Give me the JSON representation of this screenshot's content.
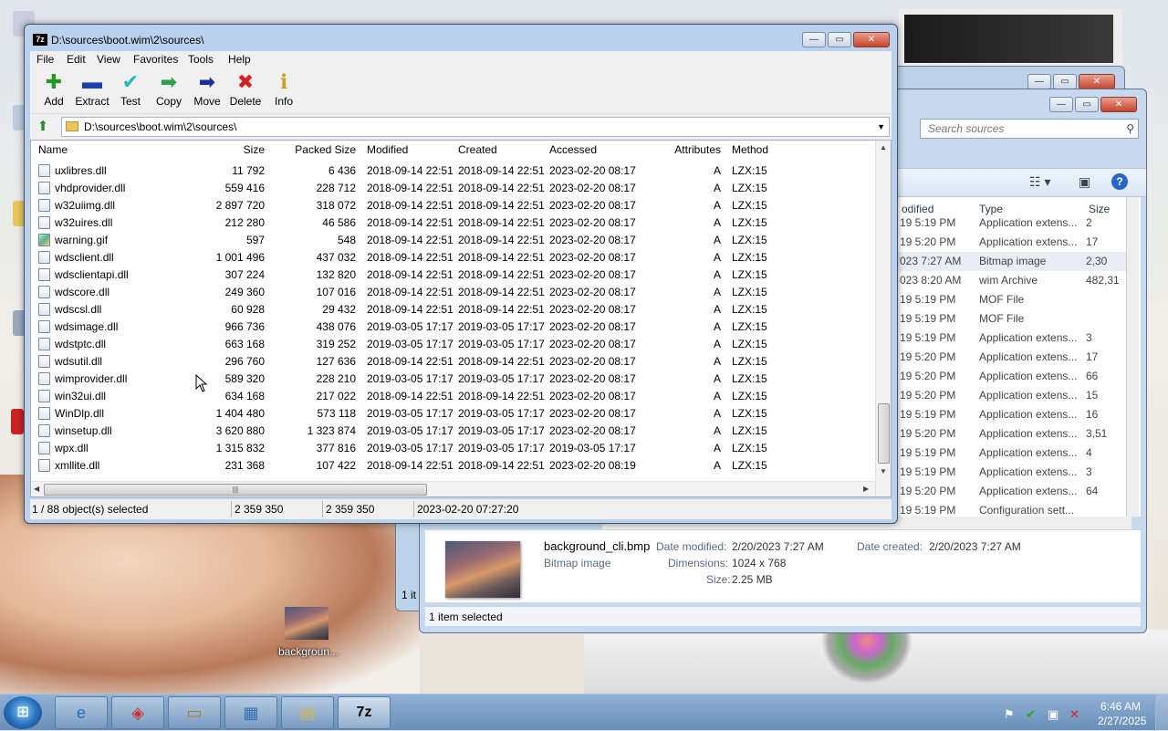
{
  "explorer": {
    "search_placeholder": "Search sources",
    "columns": {
      "modified": "odified",
      "type": "Type",
      "size": "Size"
    },
    "rows": [
      {
        "modified": "19 5:19 PM",
        "type": "Application extens...",
        "size": "2"
      },
      {
        "modified": "19 5:20 PM",
        "type": "Application extens...",
        "size": "17"
      },
      {
        "modified": "023 7:27 AM",
        "type": "Bitmap image",
        "size": "2,30"
      },
      {
        "modified": "023 8:20 AM",
        "type": "wim Archive",
        "size": "482,31"
      },
      {
        "modified": "19 5:19 PM",
        "type": "MOF File",
        "size": ""
      },
      {
        "modified": "19 5:19 PM",
        "type": "MOF File",
        "size": ""
      },
      {
        "modified": "19 5:19 PM",
        "type": "Application extens...",
        "size": "3"
      },
      {
        "modified": "19 5:20 PM",
        "type": "Application extens...",
        "size": "17"
      },
      {
        "modified": "19 5:20 PM",
        "type": "Application extens...",
        "size": "66"
      },
      {
        "modified": "19 5:20 PM",
        "type": "Application extens...",
        "size": "15"
      },
      {
        "modified": "19 5:19 PM",
        "type": "Application extens...",
        "size": "16"
      },
      {
        "modified": "19 5:20 PM",
        "type": "Application extens...",
        "size": "3,51"
      },
      {
        "modified": "19 5:19 PM",
        "type": "Application extens...",
        "size": "4"
      },
      {
        "modified": "19 5:19 PM",
        "type": "Application extens...",
        "size": "3"
      },
      {
        "modified": "19 5:20 PM",
        "type": "Application extens...",
        "size": "64"
      },
      {
        "modified": "19 5:19 PM",
        "type": "Configuration sett...",
        "size": ""
      }
    ],
    "details": {
      "filename": "background_cli.bmp",
      "filetype": "Bitmap image",
      "date_modified_label": "Date modified:",
      "date_modified": "2/20/2023 7:27 AM",
      "date_created_label": "Date created:",
      "date_created": "2/20/2023 7:27 AM",
      "dimensions_label": "Dimensions:",
      "dimensions": "1024 x 768",
      "size_label": "Size:",
      "size": "2.25 MB"
    },
    "status": "1 item selected",
    "back_status": "1 it"
  },
  "zip": {
    "title": "D:\\sources\\boot.wim\\2\\sources\\",
    "app_icon": "7z",
    "menu": [
      "File",
      "Edit",
      "View",
      "Favorites",
      "Tools",
      "Help"
    ],
    "toolbar": [
      {
        "label": "Add",
        "icon": "plus-icon",
        "glyph": "✚",
        "color": "#1f9a1f"
      },
      {
        "label": "Extract",
        "icon": "minus-icon",
        "glyph": "▬",
        "color": "#1c3fb0"
      },
      {
        "label": "Test",
        "icon": "check-icon",
        "glyph": "✔",
        "color": "#27b7b7"
      },
      {
        "label": "Copy",
        "icon": "copy-arrow-icon",
        "glyph": "➡",
        "color": "#2aa04a"
      },
      {
        "label": "Move",
        "icon": "move-arrow-icon",
        "glyph": "➡",
        "color": "#1b2f9a"
      },
      {
        "label": "Delete",
        "icon": "delete-x-icon",
        "glyph": "✖",
        "color": "#d42020"
      },
      {
        "label": "Info",
        "icon": "info-icon",
        "glyph": "ℹ",
        "color": "#c7a21c"
      }
    ],
    "address": "D:\\sources\\boot.wim\\2\\sources\\",
    "columns": [
      "Name",
      "Size",
      "Packed Size",
      "Modified",
      "Created",
      "Accessed",
      "Attributes",
      "Method"
    ],
    "files": [
      {
        "name": "uxlibres.dll",
        "size": "11 792",
        "packed": "6 436",
        "modified": "2018-09-14 22:51",
        "created": "2018-09-14 22:51",
        "accessed": "2023-02-20 08:17",
        "attr": "A",
        "method": "LZX:15",
        "icon": "dll"
      },
      {
        "name": "vhdprovider.dll",
        "size": "559 416",
        "packed": "228 712",
        "modified": "2018-09-14 22:51",
        "created": "2018-09-14 22:51",
        "accessed": "2023-02-20 08:17",
        "attr": "A",
        "method": "LZX:15",
        "icon": "dll"
      },
      {
        "name": "w32uiimg.dll",
        "size": "2 897 720",
        "packed": "318 072",
        "modified": "2018-09-14 22:51",
        "created": "2018-09-14 22:51",
        "accessed": "2023-02-20 08:17",
        "attr": "A",
        "method": "LZX:15",
        "icon": "dll"
      },
      {
        "name": "w32uires.dll",
        "size": "212 280",
        "packed": "46 586",
        "modified": "2018-09-14 22:51",
        "created": "2018-09-14 22:51",
        "accessed": "2023-02-20 08:17",
        "attr": "A",
        "method": "LZX:15",
        "icon": "dll"
      },
      {
        "name": "warning.gif",
        "size": "597",
        "packed": "548",
        "modified": "2018-09-14 22:51",
        "created": "2018-09-14 22:51",
        "accessed": "2023-02-20 08:17",
        "attr": "A",
        "method": "LZX:15",
        "icon": "img"
      },
      {
        "name": "wdsclient.dll",
        "size": "1 001 496",
        "packed": "437 032",
        "modified": "2018-09-14 22:51",
        "created": "2018-09-14 22:51",
        "accessed": "2023-02-20 08:17",
        "attr": "A",
        "method": "LZX:15",
        "icon": "dll"
      },
      {
        "name": "wdsclientapi.dll",
        "size": "307 224",
        "packed": "132 820",
        "modified": "2018-09-14 22:51",
        "created": "2018-09-14 22:51",
        "accessed": "2023-02-20 08:17",
        "attr": "A",
        "method": "LZX:15",
        "icon": "dll"
      },
      {
        "name": "wdscore.dll",
        "size": "249 360",
        "packed": "107 016",
        "modified": "2018-09-14 22:51",
        "created": "2018-09-14 22:51",
        "accessed": "2023-02-20 08:17",
        "attr": "A",
        "method": "LZX:15",
        "icon": "dll"
      },
      {
        "name": "wdscsl.dll",
        "size": "60 928",
        "packed": "29 432",
        "modified": "2018-09-14 22:51",
        "created": "2018-09-14 22:51",
        "accessed": "2023-02-20 08:17",
        "attr": "A",
        "method": "LZX:15",
        "icon": "dll"
      },
      {
        "name": "wdsimage.dll",
        "size": "966 736",
        "packed": "438 076",
        "modified": "2019-03-05 17:17",
        "created": "2019-03-05 17:17",
        "accessed": "2023-02-20 08:17",
        "attr": "A",
        "method": "LZX:15",
        "icon": "dll"
      },
      {
        "name": "wdstptc.dll",
        "size": "663 168",
        "packed": "319 252",
        "modified": "2019-03-05 17:17",
        "created": "2019-03-05 17:17",
        "accessed": "2023-02-20 08:17",
        "attr": "A",
        "method": "LZX:15",
        "icon": "dll"
      },
      {
        "name": "wdsutil.dll",
        "size": "296 760",
        "packed": "127 636",
        "modified": "2018-09-14 22:51",
        "created": "2018-09-14 22:51",
        "accessed": "2023-02-20 08:17",
        "attr": "A",
        "method": "LZX:15",
        "icon": "dll"
      },
      {
        "name": "wimprovider.dll",
        "size": "589 320",
        "packed": "228 210",
        "modified": "2019-03-05 17:17",
        "created": "2019-03-05 17:17",
        "accessed": "2023-02-20 08:17",
        "attr": "A",
        "method": "LZX:15",
        "icon": "dll"
      },
      {
        "name": "win32ui.dll",
        "size": "634 168",
        "packed": "217 022",
        "modified": "2018-09-14 22:51",
        "created": "2018-09-14 22:51",
        "accessed": "2023-02-20 08:17",
        "attr": "A",
        "method": "LZX:15",
        "icon": "dll"
      },
      {
        "name": "WinDlp.dll",
        "size": "1 404 480",
        "packed": "573 118",
        "modified": "2019-03-05 17:17",
        "created": "2019-03-05 17:17",
        "accessed": "2023-02-20 08:17",
        "attr": "A",
        "method": "LZX:15",
        "icon": "dll"
      },
      {
        "name": "winsetup.dll",
        "size": "3 620 880",
        "packed": "1 323 874",
        "modified": "2019-03-05 17:17",
        "created": "2019-03-05 17:17",
        "accessed": "2023-02-20 08:17",
        "attr": "A",
        "method": "LZX:15",
        "icon": "dll"
      },
      {
        "name": "wpx.dll",
        "size": "1 315 832",
        "packed": "377 816",
        "modified": "2019-03-05 17:17",
        "created": "2019-03-05 17:17",
        "accessed": "2019-03-05 17:17",
        "attr": "A",
        "method": "LZX:15",
        "icon": "dll"
      },
      {
        "name": "xmllite.dll",
        "size": "231 368",
        "packed": "107 422",
        "modified": "2018-09-14 22:51",
        "created": "2018-09-14 22:51",
        "accessed": "2023-02-20 08:19",
        "attr": "A",
        "method": "LZX:15",
        "icon": "dll"
      }
    ],
    "status": {
      "selected": "1 / 88 object(s) selected",
      "size": "2 359 350",
      "packed": "2 359 350",
      "date": "2023-02-20 07:27:20"
    }
  },
  "desktop": {
    "bmp_icon_label": "backgroun..."
  },
  "taskbar": {
    "start_icon": "windows-start-icon",
    "buttons": [
      {
        "name": "internet-explorer",
        "glyph": "e",
        "color": "#1e6ec7"
      },
      {
        "name": "red-app",
        "glyph": "◈",
        "color": "#c83232"
      },
      {
        "name": "archive-box",
        "glyph": "▭",
        "color": "#b07a2a"
      },
      {
        "name": "control-panel",
        "glyph": "▦",
        "color": "#3a6fb0"
      },
      {
        "name": "file-explorer",
        "glyph": "▤",
        "color": "#d8b24a"
      },
      {
        "name": "7zip",
        "glyph": "7z",
        "color": "#000000"
      }
    ],
    "time": "6:46 AM",
    "date": "2/27/2025"
  }
}
